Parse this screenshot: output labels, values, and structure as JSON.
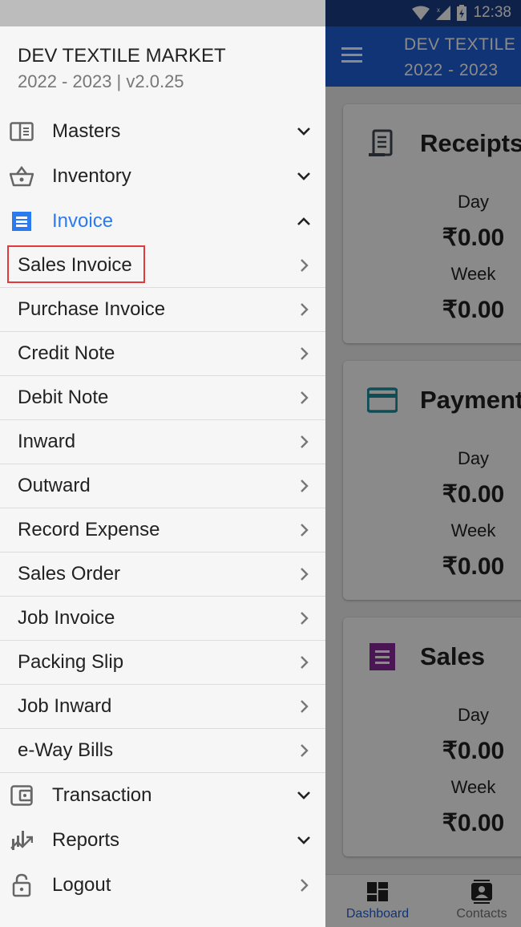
{
  "status_bar": {
    "time": "12:38",
    "icons": [
      "wifi-icon",
      "signal-off-icon",
      "battery-charging-icon"
    ]
  },
  "app_bar": {
    "title_line1": "DEV TEXTILE",
    "title_line2": "2022 - 2023",
    "menu_icon": "hamburger-icon"
  },
  "dashboard": {
    "cards": [
      {
        "title": "Receipts",
        "icon": "receipt-scroll-icon",
        "icon_color": "#3f4653",
        "day_label": "Day",
        "day_value": "₹0.00",
        "week_label": "Week",
        "week_value": "₹0.00"
      },
      {
        "title": "Payment",
        "icon": "credit-card-icon",
        "icon_color": "#1a8f9f",
        "day_label": "Day",
        "day_value": "₹0.00",
        "week_label": "Week",
        "week_value": "₹0.00"
      },
      {
        "title": "Sales",
        "icon": "receipt-icon",
        "icon_color": "#8a2a9a",
        "day_label": "Day",
        "day_value": "₹0.00",
        "week_label": "Week",
        "week_value": "₹0.00"
      }
    ]
  },
  "bottom_nav": {
    "items": [
      {
        "label": "Dashboard",
        "icon": "dashboard-icon",
        "active": true
      },
      {
        "label": "Contacts",
        "icon": "contacts-icon",
        "active": false
      }
    ]
  },
  "drawer": {
    "title": "DEV TEXTILE MARKET",
    "subtitle": "2022 - 2023 | v2.0.25",
    "menu": [
      {
        "label": "Masters",
        "icon": "book-open-icon",
        "state": "collapsed"
      },
      {
        "label": "Inventory",
        "icon": "basket-icon",
        "state": "collapsed"
      },
      {
        "label": "Invoice",
        "icon": "receipt-icon",
        "state": "expanded",
        "active": true
      },
      {
        "label": "Transaction",
        "icon": "wallet-icon",
        "state": "collapsed"
      },
      {
        "label": "Reports",
        "icon": "chart-trend-icon",
        "state": "collapsed"
      },
      {
        "label": "Logout",
        "icon": "lock-open-icon",
        "state": "link"
      }
    ],
    "invoice_submenu": [
      {
        "label": "Sales Invoice",
        "highlighted": true
      },
      {
        "label": "Purchase Invoice"
      },
      {
        "label": "Credit Note"
      },
      {
        "label": "Debit Note"
      },
      {
        "label": "Inward"
      },
      {
        "label": "Outward"
      },
      {
        "label": "Record Expense"
      },
      {
        "label": "Sales Order"
      },
      {
        "label": "Job Invoice"
      },
      {
        "label": "Packing Slip"
      },
      {
        "label": "Job Inward"
      },
      {
        "label": "e-Way Bills"
      }
    ],
    "accent_color": "#2b7bf0",
    "highlight_color": "#e03a3a"
  }
}
